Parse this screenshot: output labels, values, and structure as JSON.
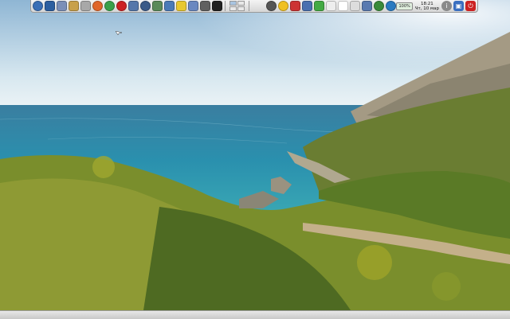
{
  "panel": {
    "launchers": [
      {
        "icon": "app-menu-icon",
        "color": "#3b6fb6"
      },
      {
        "icon": "desktop-icon",
        "color": "#2d5fa0"
      },
      {
        "icon": "file-manager-icon",
        "color": "#7b8fb8"
      },
      {
        "icon": "settings-tools-icon",
        "color": "#c8a04a"
      },
      {
        "icon": "trash-icon",
        "color": "#a8a8a8"
      },
      {
        "icon": "firefox-icon",
        "color": "#e0662a"
      },
      {
        "icon": "chrome-icon",
        "color": "#3aa04a"
      },
      {
        "icon": "opera-icon",
        "color": "#cc2222"
      },
      {
        "icon": "music-note-icon",
        "color": "#5577aa"
      },
      {
        "icon": "steam-icon",
        "color": "#3a5a88"
      },
      {
        "icon": "package-manager-icon",
        "color": "#5a8a5a"
      },
      {
        "icon": "text-editor-icon",
        "color": "#4a7ab8"
      },
      {
        "icon": "notes-icon",
        "color": "#e8c830"
      },
      {
        "icon": "word-processor-icon",
        "color": "#6a88c0"
      },
      {
        "icon": "pencil-icon",
        "color": "#606060"
      },
      {
        "icon": "terminal-icon",
        "color": "#222222"
      }
    ],
    "tray": [
      {
        "icon": "back-arrow-icon",
        "color": "#555555"
      },
      {
        "icon": "weather-sun-icon",
        "color": "#f0c020"
      },
      {
        "icon": "keyboard-layout-icon",
        "color": "#cc3333"
      },
      {
        "icon": "network-icon",
        "color": "#4a70b0"
      },
      {
        "icon": "signal-icon",
        "color": "#44aa44"
      },
      {
        "icon": "clipboard-icon",
        "color": "#eeeeee"
      },
      {
        "icon": "document-icon",
        "color": "#ffffff"
      },
      {
        "icon": "image-icon",
        "color": "#dddddd"
      },
      {
        "icon": "network-share-icon",
        "color": "#5a7ab0"
      },
      {
        "icon": "update-icon",
        "color": "#3a8a3a"
      },
      {
        "icon": "globe-icon",
        "color": "#2a7ac0"
      }
    ],
    "battery": "100%",
    "clock": {
      "time": "18:21",
      "date": "Чт, 10 мар"
    },
    "controls": [
      {
        "icon": "info-icon",
        "color": "#8a8a8a"
      },
      {
        "icon": "lock-icon",
        "color": "#3a6fc0"
      },
      {
        "icon": "power-icon",
        "color": "#cc2222"
      }
    ]
  },
  "wallpaper": {
    "sky_top": "#8fb6d4",
    "sky_bottom": "#e8f0f4",
    "sea": "#2e8aa8",
    "cliff": "#9a8e74",
    "vegetation": "#6e8a2a"
  }
}
